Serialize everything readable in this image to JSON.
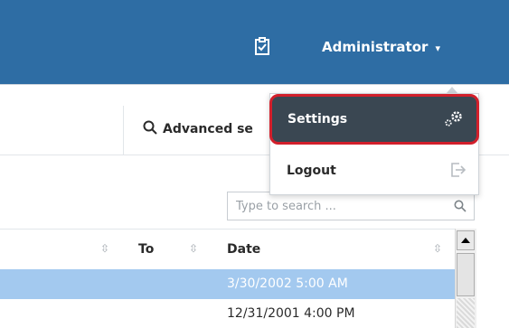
{
  "header": {
    "tasks_icon": "clipboard-check-icon",
    "user_label": "Administrator",
    "user_caret": "▾",
    "colors": {
      "bar": "#2e6da4",
      "text": "#ffffff"
    }
  },
  "toolbar": {
    "advanced_search_label": "Advanced se",
    "search_icon": "magnifier-icon"
  },
  "search": {
    "placeholder": "Type to search ..."
  },
  "grid": {
    "columns": [
      {
        "label": "To"
      },
      {
        "label": "Date"
      }
    ],
    "rows": [
      {
        "date": "3/30/2002 5:00 AM",
        "selected": true
      },
      {
        "date": "12/31/2001 4:00 PM",
        "selected": false
      }
    ],
    "colors": {
      "selected_row": "#a3c9ef"
    }
  },
  "user_menu": {
    "items": [
      {
        "label": "Settings",
        "icon": "cogs-icon"
      },
      {
        "label": "Logout",
        "icon": "logout-icon"
      }
    ],
    "colors": {
      "highlight_bg": "#3a4752",
      "highlight_border": "#d21f2b"
    }
  }
}
